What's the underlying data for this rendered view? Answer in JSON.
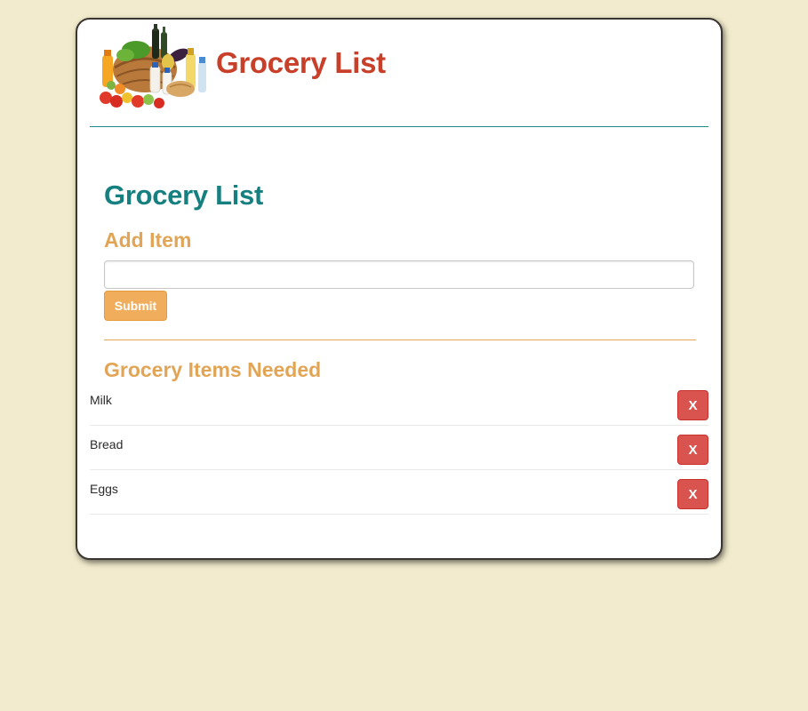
{
  "header": {
    "logo_image": "grocery-basket-image",
    "title": "Grocery List"
  },
  "main": {
    "title": "Grocery List",
    "add_section": {
      "heading": "Add Item",
      "input_value": "",
      "submit_label": "Submit"
    },
    "list_section": {
      "heading": "Grocery Items Needed",
      "items": [
        {
          "name": "Milk",
          "delete_label": "X"
        },
        {
          "name": "Bread",
          "delete_label": "X"
        },
        {
          "name": "Eggs",
          "delete_label": "X"
        }
      ]
    }
  },
  "colors": {
    "page_background": "#f2ebcd",
    "header_title": "#c8402a",
    "main_title": "#15807f",
    "section_heading": "#e2a556",
    "submit_button": "#f0ad5c",
    "delete_button": "#d9534f"
  }
}
